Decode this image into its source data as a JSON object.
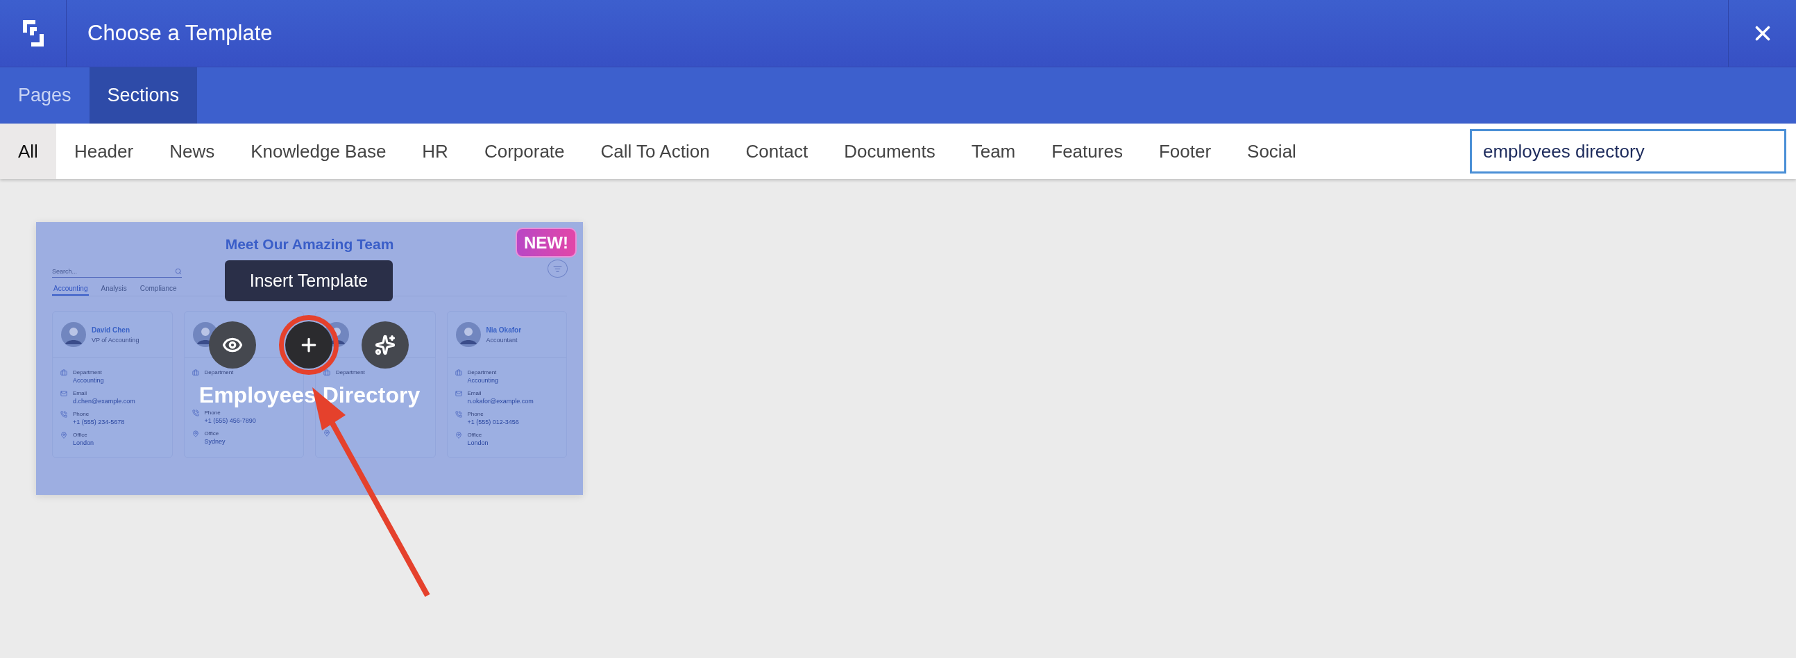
{
  "window": {
    "title": "Choose a Template"
  },
  "tabs": [
    {
      "label": "Pages",
      "selected": false
    },
    {
      "label": "Sections",
      "selected": true
    }
  ],
  "categories": [
    {
      "label": "All",
      "selected": true
    },
    {
      "label": "Header",
      "selected": false
    },
    {
      "label": "News",
      "selected": false
    },
    {
      "label": "Knowledge Base",
      "selected": false
    },
    {
      "label": "HR",
      "selected": false
    },
    {
      "label": "Corporate",
      "selected": false
    },
    {
      "label": "Call To Action",
      "selected": false
    },
    {
      "label": "Contact",
      "selected": false
    },
    {
      "label": "Documents",
      "selected": false
    },
    {
      "label": "Team",
      "selected": false
    },
    {
      "label": "Features",
      "selected": false
    },
    {
      "label": "Footer",
      "selected": false
    },
    {
      "label": "Social",
      "selected": false
    }
  ],
  "search": {
    "value": "employees directory"
  },
  "template": {
    "name": "Employees Directory",
    "badge": "NEW!",
    "tooltip": "Insert Template",
    "actions": [
      {
        "kind": "preview",
        "highlighted": false
      },
      {
        "kind": "insert",
        "highlighted": true
      },
      {
        "kind": "ai",
        "highlighted": false
      }
    ],
    "preview": {
      "title": "Meet Our Amazing Team",
      "search_placeholder": "Search...",
      "tabs": [
        {
          "label": "Accounting",
          "selected": true
        },
        {
          "label": "Analysis",
          "selected": false
        },
        {
          "label": "Compliance",
          "selected": false
        }
      ],
      "cards": [
        {
          "name": "David Chen",
          "role": "VP of Accounting",
          "fields": [
            {
              "kind": "department",
              "label": "Department",
              "value": "Accounting"
            },
            {
              "kind": "email",
              "label": "Email",
              "value": "d.chen@example.com"
            },
            {
              "kind": "phone",
              "label": "Phone",
              "value": "+1 (555) 234-5678"
            },
            {
              "kind": "office",
              "label": "Office",
              "value": "London"
            }
          ]
        },
        {
          "fields": [
            {
              "kind": "department",
              "label": "Department"
            },
            {
              "kind": "covered"
            },
            {
              "kind": "phone",
              "label": "Phone",
              "value": "+1 (555) 456-7890"
            },
            {
              "kind": "office",
              "label": "Office",
              "value": "Sydney"
            }
          ]
        },
        {
          "fields": [
            {
              "kind": "department",
              "label": "Department"
            },
            {
              "kind": "covered"
            },
            {
              "kind": "covered"
            },
            {
              "kind": "office"
            }
          ]
        },
        {
          "name": "Nia Okafor",
          "role": "Accountant",
          "fields": [
            {
              "kind": "department",
              "label": "Department",
              "value": "Accounting"
            },
            {
              "kind": "email",
              "label": "Email",
              "value": "n.okafor@example.com"
            },
            {
              "kind": "phone",
              "label": "Phone",
              "value": "+1 (555) 012-3456"
            },
            {
              "kind": "office",
              "label": "Office",
              "value": "London"
            }
          ]
        }
      ]
    }
  },
  "annotations": [
    {
      "kind": "arrow"
    }
  ]
}
